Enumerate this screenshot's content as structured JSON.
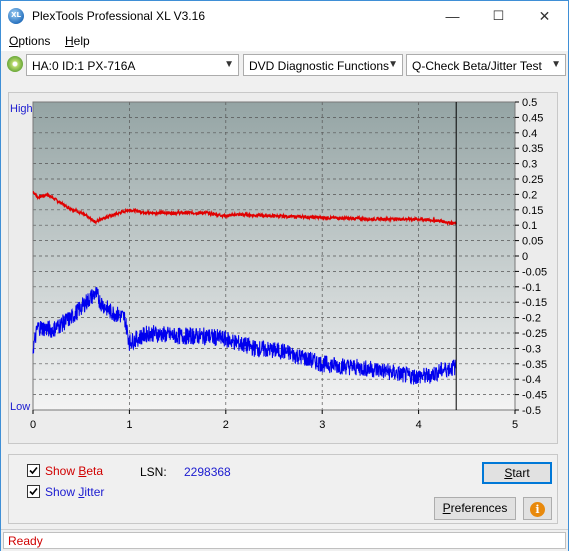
{
  "window": {
    "title": "PlexTools Professional XL V3.16",
    "icon_text": "XL",
    "buttons": {
      "minimize": "—",
      "maximize": "☐",
      "close": "✕"
    }
  },
  "menu": [
    {
      "label": "Options",
      "accel": "O",
      "rest": "ptions"
    },
    {
      "label": "Help",
      "accel": "H",
      "rest": "elp"
    }
  ],
  "toolbar": {
    "drive": "HA:0 ID:1  PX-716A",
    "function": "DVD Diagnostic Functions",
    "test": "Q-Check Beta/Jitter Test"
  },
  "chart_labels": {
    "high": "High",
    "low": "Low"
  },
  "chart_data": {
    "type": "line",
    "x_ticks": [
      "0",
      "1",
      "2",
      "3",
      "4",
      "5"
    ],
    "xlim": [
      0,
      5
    ],
    "y_ticks": [
      "0.5",
      "0.45",
      "0.4",
      "0.35",
      "0.3",
      "0.25",
      "0.2",
      "0.15",
      "0.1",
      "0.05",
      "0",
      "-0.05",
      "-0.1",
      "-0.15",
      "-0.2",
      "-0.25",
      "-0.3",
      "-0.35",
      "-0.4",
      "-0.45",
      "-0.5"
    ],
    "ylim": [
      -0.5,
      0.5
    ],
    "grid": true,
    "end_marker_x": 4.39,
    "series": [
      {
        "name": "Beta",
        "color": "#e00000",
        "x": [
          0,
          0.05,
          0.15,
          0.25,
          0.35,
          0.5,
          0.6,
          0.65,
          0.7,
          0.8,
          0.9,
          1.0,
          1.2,
          1.5,
          1.8,
          2.0,
          2.1,
          2.5,
          3.0,
          3.5,
          4.0,
          4.2,
          4.39
        ],
        "y": [
          0.21,
          0.19,
          0.2,
          0.18,
          0.16,
          0.14,
          0.12,
          0.11,
          0.12,
          0.13,
          0.14,
          0.15,
          0.14,
          0.14,
          0.14,
          0.13,
          0.135,
          0.13,
          0.125,
          0.12,
          0.12,
          0.115,
          0.105
        ]
      },
      {
        "name": "Jitter",
        "color": "#0000ee",
        "x": [
          0,
          0.05,
          0.2,
          0.4,
          0.55,
          0.65,
          0.7,
          0.8,
          0.95,
          1.0,
          1.2,
          1.5,
          1.8,
          2.0,
          2.3,
          2.6,
          2.8,
          3.0,
          3.3,
          3.6,
          3.9,
          4.1,
          4.25,
          4.39
        ],
        "y": [
          -0.3,
          -0.23,
          -0.24,
          -0.2,
          -0.15,
          -0.12,
          -0.15,
          -0.18,
          -0.2,
          -0.28,
          -0.25,
          -0.26,
          -0.26,
          -0.27,
          -0.3,
          -0.31,
          -0.33,
          -0.35,
          -0.36,
          -0.37,
          -0.39,
          -0.39,
          -0.37,
          -0.36
        ]
      }
    ]
  },
  "options": {
    "show_beta": {
      "label": "Show Beta",
      "pre": "Show ",
      "accel": "B",
      "rest": "eta",
      "checked": true,
      "color": "#d00000"
    },
    "show_jitter": {
      "label": "Show Jitter",
      "pre": "Show ",
      "accel": "J",
      "rest": "itter",
      "checked": true,
      "color": "#1b1bd0"
    }
  },
  "lsn": {
    "label": "LSN:",
    "value": "2298368"
  },
  "buttons": {
    "start": {
      "label": "Start",
      "accel": "S",
      "rest": "tart"
    },
    "preferences": {
      "label": "Preferences",
      "accel": "P",
      "rest": "references"
    }
  },
  "status": {
    "text": "Ready"
  }
}
